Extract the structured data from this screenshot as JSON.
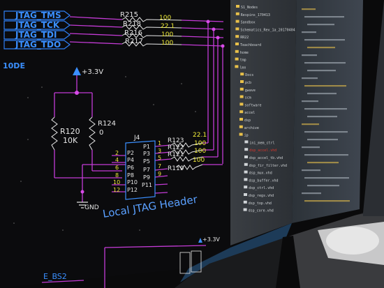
{
  "schematic": {
    "net_labels": [
      "JTAG_TMS",
      "JTAG_TCK",
      "JTAG_TDI",
      "JTAG_TDO"
    ],
    "series_resistors": [
      {
        "ref": "R215",
        "value": "100"
      },
      {
        "ref": "R218",
        "value": "22.1"
      },
      {
        "ref": "R216",
        "value": "100"
      },
      {
        "ref": "R217",
        "value": "100"
      }
    ],
    "mode_fragment": "10DE",
    "power_label": "+3.3V",
    "pullups": [
      {
        "ref": "R120",
        "value": "10K"
      },
      {
        "ref": "R124",
        "value": "0"
      }
    ],
    "connector_ref": "J4",
    "connector_pins": [
      "P1",
      "P2",
      "P3",
      "P4",
      "P5",
      "P6",
      "P7",
      "P8",
      "P9",
      "P10",
      "P11",
      "P12"
    ],
    "pin_numbers_left": [
      "2",
      "4",
      "6",
      "8",
      "10",
      "12"
    ],
    "pin_numbers_right": [
      "1",
      "3",
      "5",
      "7",
      "9",
      "11"
    ],
    "header_resistors": [
      {
        "ref": "R123",
        "value": "22.1"
      },
      {
        "ref": "R122",
        "value": "100"
      },
      {
        "ref": "R121",
        "value": "100"
      },
      {
        "ref": "R119",
        "value": "100"
      }
    ],
    "ground_label": "GND",
    "title": "Local JTAG Header",
    "lower_power_label": "+3.3V",
    "lower_net_fragment": "E_BS2"
  },
  "file_tree": {
    "items": [
      "S1_Nodes",
      "Respins_170413",
      "Sandbox",
      "Schematics_Rev_1a_20170404",
      "RR22",
      "Teachboard",
      "home",
      "tmp",
      "lmn",
      "Docs",
      "pcb",
      "gwave",
      "scm",
      "software",
      "accel",
      "dsp",
      "archive",
      "ip",
      "ini_mem_ctrl",
      "dsp_accel.vhd",
      "dsp_accel_tb.vhd",
      "dsp_fir_filter.vhd",
      "dsp_mux.vhd",
      "dsp_buffer.vhd",
      "dsp_ctrl.vhd",
      "dsp_regs.vhd",
      "dsp_top.vhd",
      "dsp_core.vhd"
    ],
    "selected_index": 19,
    "colors": {
      "folder": "#e8c04a",
      "selected": "#d9342b",
      "text": "#cfd3d6"
    }
  },
  "colors": {
    "schematic_bg": "#0b0b0d",
    "wire": "#c43bd6",
    "net_label": "#3a8fff",
    "component": "#e8e8e8",
    "resistor_text": "#f3ef3a",
    "pin_text": "#f0e63c",
    "title": "#5aa0ff"
  }
}
